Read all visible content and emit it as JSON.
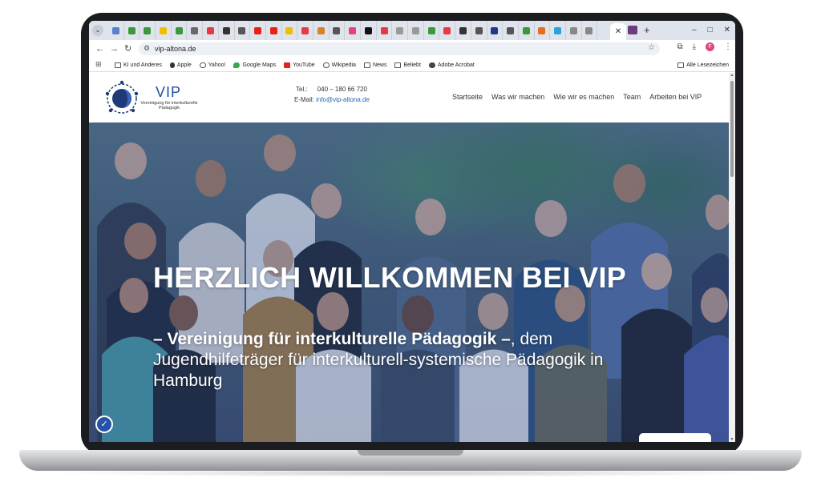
{
  "browser": {
    "tab_menu_icon": "chevron-down-icon",
    "active_tab_close": "✕",
    "new_tab": "+",
    "window_controls": [
      "–",
      "□",
      "✕"
    ],
    "tab_favicon_colors": [
      "#5a7fd0",
      "#3a9a3a",
      "#3a9a3a",
      "#f0c000",
      "#3a9a3a",
      "#6a6a6a",
      "#e63946",
      "#333333",
      "#555555",
      "#e62117",
      "#e62117",
      "#f0c000",
      "#e63946",
      "#d9822b",
      "#555555",
      "#e0457b",
      "#111111",
      "#e63946",
      "#999999",
      "#999999",
      "#3a9a3a",
      "#e63946",
      "#333333",
      "#555555",
      "#1f3a8a",
      "#555555",
      "#3a9a3a",
      "#e07020",
      "#2aa3d8",
      "#888888",
      "#888888"
    ]
  },
  "toolbar": {
    "back": "←",
    "forward": "→",
    "reload": "↻",
    "url": "vip-altona.de",
    "bookmark_star": "☆",
    "profile_initial": "F"
  },
  "bookmarks": {
    "items": [
      {
        "label": "KI und Anderes",
        "icon": "folder-icon"
      },
      {
        "label": "Apple",
        "icon": "apple-icon"
      },
      {
        "label": "Yahoo!",
        "icon": "globe-icon"
      },
      {
        "label": "Google Maps",
        "icon": "map-pin-icon"
      },
      {
        "label": "YouTube",
        "icon": "youtube-icon"
      },
      {
        "label": "Wikipedia",
        "icon": "globe-icon"
      },
      {
        "label": "News",
        "icon": "folder-icon"
      },
      {
        "label": "Beliebt",
        "icon": "folder-icon"
      },
      {
        "label": "Adobe Acrobat",
        "icon": "acrobat-icon"
      }
    ],
    "all_bookmarks": "Alle Lesezeichen"
  },
  "site": {
    "logo_text": "VIP",
    "logo_subtitle_line1": "Vereinigung für interkulturelle",
    "logo_subtitle_line2": "Pädagogik",
    "contact": {
      "tel_label": "Tel.:",
      "tel_value": "040 – 180 66 720",
      "email_label": "E-Mail:",
      "email_value": "info@vip-altona.de"
    },
    "nav": [
      "Startseite",
      "Was wir machen",
      "Wie wir es machen",
      "Team",
      "Arbeiten bei VIP"
    ]
  },
  "hero": {
    "title": "HERZLICH WILLKOMMEN BEI VIP",
    "subtitle_bold": "– Vereinigung für interkulturelle Pädagogik –",
    "subtitle_rest": ", dem Jugendhilfeträger für interkulturell-systemische Pädagogik in Hamburg",
    "accessibility_button": "accessibility-icon"
  }
}
